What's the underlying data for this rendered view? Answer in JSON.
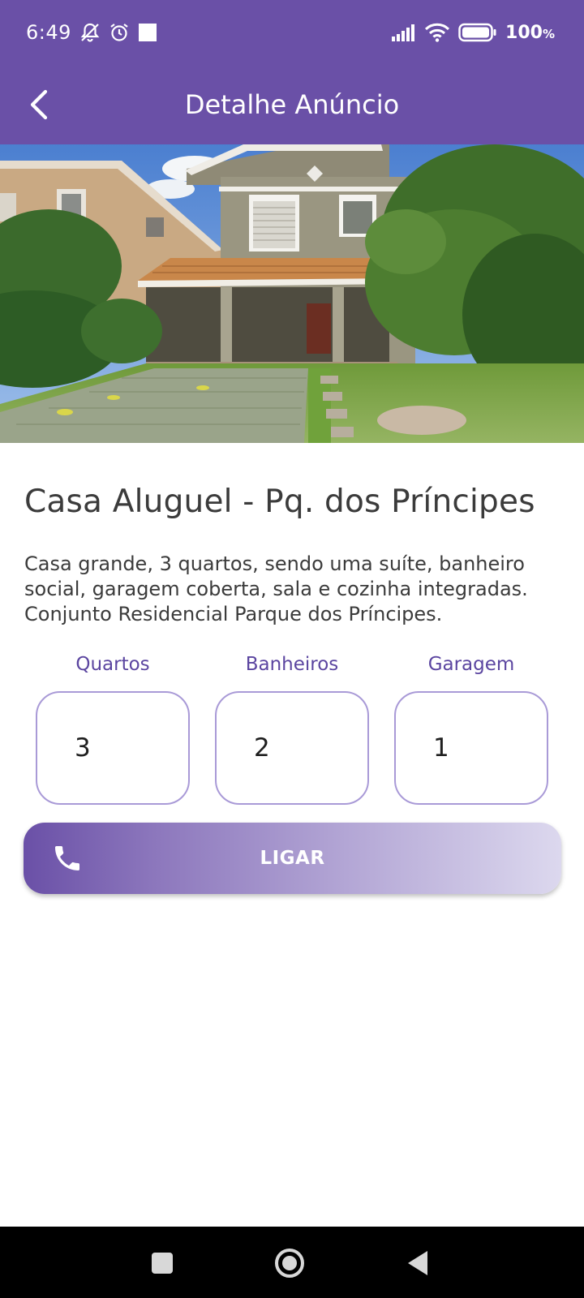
{
  "status_bar": {
    "time": "6:49",
    "battery": "100",
    "battery_unit": "%",
    "icons": [
      "mute-icon",
      "alarm-icon",
      "notification-square-icon",
      "signal-icon",
      "wifi-icon",
      "battery-icon"
    ]
  },
  "app_bar": {
    "title": "Detalhe Anúncio",
    "back_icon": "chevron-left-icon"
  },
  "listing": {
    "image_alt": "house photo",
    "title": "Casa Aluguel - Pq. dos Príncipes",
    "description": "Casa grande, 3 quartos, sendo uma suíte, banheiro social, garagem coberta, sala e cozinha integradas. Conjunto Residencial Parque dos Príncipes.",
    "stats": [
      {
        "label": "Quartos",
        "value": "3"
      },
      {
        "label": "Banheiros",
        "value": "2"
      },
      {
        "label": "Garagem",
        "value": "1"
      }
    ]
  },
  "call_button": {
    "label": "LIGAR",
    "icon": "phone-icon"
  },
  "nav_bar": {
    "icons": [
      "recents-square-icon",
      "home-circle-icon",
      "back-triangle-icon"
    ]
  },
  "colors": {
    "primary": "#6a50a7",
    "stat_label": "#5b45a0",
    "stat_border": "#a99ad7"
  }
}
